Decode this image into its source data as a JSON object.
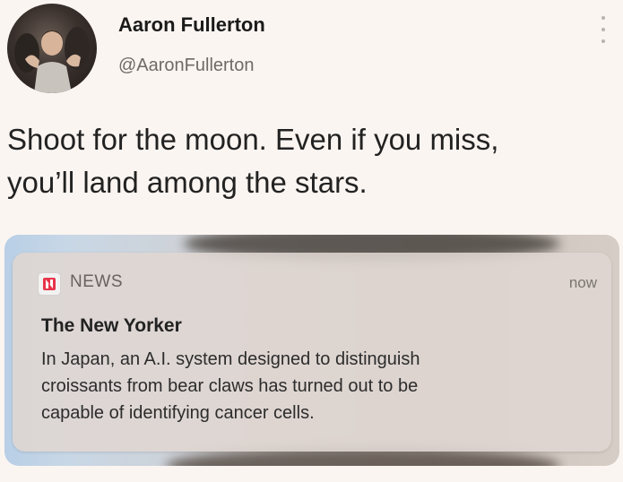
{
  "tweet": {
    "display_name": "Aaron Fullerton",
    "handle": "@AaronFullerton",
    "more_icon": "more-vertical-icon",
    "text_line1": "Shoot for the moon. Even if you miss,",
    "text_line2": "you’ll land among the stars."
  },
  "notification": {
    "app_icon": "news-icon",
    "app_name": "NEWS",
    "time": "now",
    "title": "The New Yorker",
    "body_line1": "In Japan, an A.I. system designed to distinguish",
    "body_line2": "croissants from bear claws has turned out to be",
    "body_line3": "capable of identifying cancer cells.",
    "colors": {
      "accent": "#e8344a"
    }
  }
}
